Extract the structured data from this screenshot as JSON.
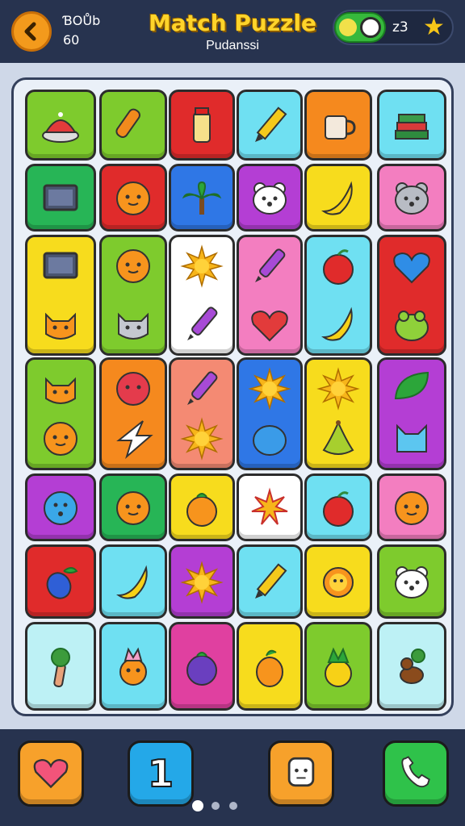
{
  "header": {
    "stat_top": "ƁOŮb",
    "stat_bottom": "60",
    "title": "Match Puzzle",
    "subtitle": "Pudanssi",
    "count": "z3"
  },
  "colors": {
    "lime": "#7ecb2d",
    "red": "#e02b2b",
    "cyan": "#6fe0f2",
    "orange": "#f5891e",
    "green": "#27b556",
    "blue": "#2f77e6",
    "purple": "#b43ed4",
    "yellow": "#f7dc1d",
    "pink": "#f37ec0",
    "white": "#ffffff",
    "salmon": "#f48a73",
    "lightcyan": "#bdf1f5",
    "magenta": "#e040a0"
  },
  "board": {
    "tiles": [
      {
        "id": "r1c1",
        "color": "lime",
        "icons": [
          "cap-icon"
        ]
      },
      {
        "id": "r1c2",
        "color": "lime",
        "icons": [
          "cone-icon"
        ]
      },
      {
        "id": "r1c3",
        "color": "red",
        "icons": [
          "bottle-icon"
        ]
      },
      {
        "id": "r1c4",
        "color": "cyan",
        "icons": [
          "pencil-icon"
        ]
      },
      {
        "id": "r1c5",
        "color": "orange",
        "icons": [
          "mug-icon"
        ]
      },
      {
        "id": "r1c6",
        "color": "cyan",
        "icons": [
          "books-icon"
        ]
      },
      {
        "id": "r2c1",
        "color": "green",
        "icons": [
          "screen-icon"
        ]
      },
      {
        "id": "r2c2",
        "color": "red",
        "icons": [
          "orange-face-icon"
        ]
      },
      {
        "id": "r2c3",
        "color": "blue",
        "icons": [
          "palm-icon"
        ]
      },
      {
        "id": "r2c4",
        "color": "purple",
        "icons": [
          "white-bear-icon"
        ]
      },
      {
        "id": "r2c5",
        "color": "yellow",
        "icons": [
          "banana-icon"
        ]
      },
      {
        "id": "r2c6",
        "color": "pink",
        "icons": [
          "grey-bear-icon"
        ]
      },
      {
        "id": "r3c1",
        "color": "yellow",
        "icons": [
          "screen-icon",
          "cat-icon"
        ]
      },
      {
        "id": "r3c2",
        "color": "lime",
        "icons": [
          "orange-face-icon",
          "grey-cat-icon"
        ]
      },
      {
        "id": "r3c3",
        "color": "white",
        "icons": [
          "sun-icon",
          "marker-icon"
        ]
      },
      {
        "id": "r3c4",
        "color": "pink",
        "icons": [
          "marker-icon",
          "heart-icon"
        ]
      },
      {
        "id": "r3c5",
        "color": "cyan",
        "icons": [
          "apple-icon",
          "banana-icon"
        ]
      },
      {
        "id": "r3c6",
        "color": "red",
        "icons": [
          "blue-heart-icon",
          "frog-icon"
        ]
      },
      {
        "id": "r4c1",
        "color": "lime",
        "icons": [
          "cat-icon",
          "orange-face-icon"
        ]
      },
      {
        "id": "r4c2",
        "color": "orange",
        "icons": [
          "red-face-icon",
          "star-icon"
        ]
      },
      {
        "id": "r4c3",
        "color": "salmon",
        "icons": [
          "marker-icon",
          "sun-icon"
        ]
      },
      {
        "id": "r4c4",
        "color": "blue",
        "icons": [
          "sun-icon",
          "blue-blob-icon"
        ]
      },
      {
        "id": "r4c5",
        "color": "yellow",
        "icons": [
          "sun-icon",
          "pear-icon"
        ]
      },
      {
        "id": "r4c6",
        "color": "purple",
        "icons": [
          "leaf-icon",
          "cat-head-icon"
        ]
      },
      {
        "id": "r5c1",
        "color": "purple",
        "icons": [
          "blue-face-icon"
        ]
      },
      {
        "id": "r5c2",
        "color": "green",
        "icons": [
          "orange-face-icon"
        ]
      },
      {
        "id": "r5c3",
        "color": "yellow",
        "icons": [
          "orange-fruit-icon"
        ]
      },
      {
        "id": "r5c4",
        "color": "white",
        "icons": [
          "burst-icon"
        ]
      },
      {
        "id": "r5c5",
        "color": "cyan",
        "icons": [
          "apple-icon"
        ]
      },
      {
        "id": "r5c6",
        "color": "pink",
        "icons": [
          "orange-face-icon"
        ]
      },
      {
        "id": "r6c1",
        "color": "red",
        "icons": [
          "berry-icon"
        ]
      },
      {
        "id": "r6c2",
        "color": "cyan",
        "icons": [
          "banana-icon"
        ]
      },
      {
        "id": "r6c3",
        "color": "purple",
        "icons": [
          "sun-icon"
        ]
      },
      {
        "id": "r6c4",
        "color": "cyan",
        "icons": [
          "pencil-icon"
        ]
      },
      {
        "id": "r6c5",
        "color": "yellow",
        "icons": [
          "flower-icon"
        ]
      },
      {
        "id": "r6c6",
        "color": "lime",
        "icons": [
          "white-bear-icon"
        ]
      },
      {
        "id": "r7c1",
        "color": "lightcyan",
        "icons": [
          "tree-icon"
        ]
      },
      {
        "id": "r7c2",
        "color": "cyan",
        "icons": [
          "pineapple-face-icon"
        ]
      },
      {
        "id": "r7c3",
        "color": "magenta",
        "icons": [
          "plum-icon"
        ]
      },
      {
        "id": "r7c4",
        "color": "yellow",
        "icons": [
          "mango-icon"
        ]
      },
      {
        "id": "r7c5",
        "color": "lime",
        "icons": [
          "pineapple-icon"
        ]
      },
      {
        "id": "r7c6",
        "color": "lightcyan",
        "icons": [
          "squirrel-icon"
        ]
      }
    ]
  },
  "bottom": {
    "buttons": [
      {
        "name": "heart-button",
        "icon": "heart-icon",
        "color": "#f7a12b"
      },
      {
        "name": "number-button",
        "icon": "number-icon",
        "color": "#24a8e8",
        "label": "1"
      },
      {
        "name": "face-button",
        "icon": "face-icon",
        "color": "#f7a12b"
      },
      {
        "name": "phone-button",
        "icon": "phone-icon",
        "color": "#2fc24a"
      }
    ],
    "page_indicator": {
      "pages": 3,
      "current": 1
    }
  }
}
